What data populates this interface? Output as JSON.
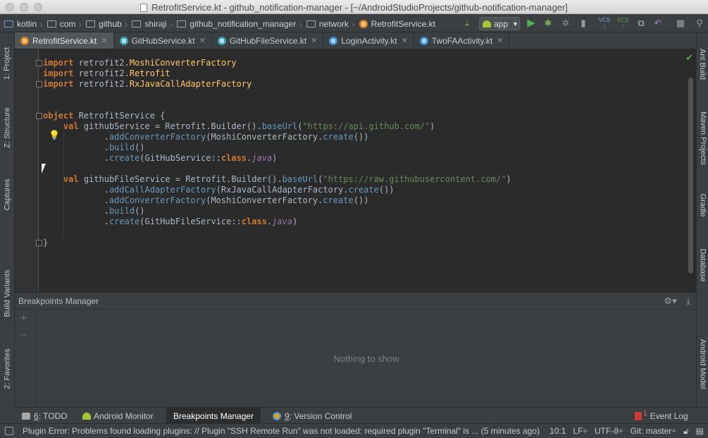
{
  "window": {
    "title": "RetrofitService.kt - github_notification-manager - [~/AndroidStudioProjects/github-notification-manager]"
  },
  "breadcrumbs": [
    {
      "label": "kotlin"
    },
    {
      "label": "com"
    },
    {
      "label": "github"
    },
    {
      "label": "shiraji"
    },
    {
      "label": "github_notification_manager"
    },
    {
      "label": "network"
    },
    {
      "label": "RetrofitService.kt"
    }
  ],
  "toolbar": {
    "run_config": "app",
    "vcs_label_1": "VCS",
    "vcs_label_2": "VCS"
  },
  "left_tools": {
    "project": "1: Project",
    "structure": "Z: Structure",
    "captures": "Captures",
    "build_variants": "Build Variants",
    "favorites": "2: Favorites"
  },
  "right_tools": {
    "ant": "Ant Build",
    "maven": "Maven Projects",
    "gradle": "Gradle",
    "database": "Database",
    "android_model": "Android Model"
  },
  "tabs": [
    {
      "label": "RetrofitService.kt",
      "active": true
    },
    {
      "label": "GitHubService.kt",
      "active": false
    },
    {
      "label": "GitHubFileService.kt",
      "active": false
    },
    {
      "label": "LoginActivity.kt",
      "active": false
    },
    {
      "label": "TwoFAActivity.kt",
      "active": false
    }
  ],
  "code": {
    "l1_kw": "import",
    "l1_pkg": " retrofit2.",
    "l1_cls": "MoshiConverterFactory",
    "l2_kw": "import",
    "l2_pkg": " retrofit2.",
    "l2_cls": "Retrofit",
    "l3_kw": "import",
    "l3_pkg": " retrofit2.",
    "l3_cls": "RxJavaCallAdapterFactory",
    "l6_kw": "object",
    "l6_rest": " RetrofitService {",
    "l7_kw": "val",
    "l7_a": " githubService = Retrofit.Builder().",
    "l7_fn": "baseUrl",
    "l7_b": "(",
    "l7_str": "\"https://api.github.com/\"",
    "l7_c": ")",
    "l8_dot": ".",
    "l8_fn": "addConverterFactory",
    "l8_a": "(MoshiConverterFactory.",
    "l8_fn2": "create",
    "l8_b": "())",
    "l9_dot": ".",
    "l9_fn": "build",
    "l9_a": "()",
    "l10_dot": ".",
    "l10_fn": "create",
    "l10_a": "(GitHubService::",
    "l10_kw": "class",
    "l10_dot2": ".",
    "l10_java": "java",
    "l10_b": ")",
    "l12_kw": "val",
    "l12_a": " githubFileService = Retrofit.Builder().",
    "l12_fn": "baseUrl",
    "l12_b": "(",
    "l12_str": "\"https://raw.githubusercontent.com/\"",
    "l12_c": ")",
    "l13_dot": ".",
    "l13_fn": "addCallAdapterFactory",
    "l13_a": "(RxJavaCallAdapterFactory.",
    "l13_fn2": "create",
    "l13_b": "())",
    "l14_dot": ".",
    "l14_fn": "addConverterFactory",
    "l14_a": "(MoshiConverterFactory.",
    "l14_fn2": "create",
    "l14_b": "())",
    "l15_dot": ".",
    "l15_fn": "build",
    "l15_a": "()",
    "l16_dot": ".",
    "l16_fn": "create",
    "l16_a": "(GitHubFileService::",
    "l16_kw": "class",
    "l16_dot2": ".",
    "l16_java": "java",
    "l16_b": ")",
    "l18": "}"
  },
  "breakpoints": {
    "title": "Breakpoints Manager",
    "empty_text": "Nothing to show",
    "add": "+",
    "remove": "−"
  },
  "bottom_tabs": {
    "todo_num": "6",
    "todo": ": TODO",
    "android_monitor": "Android Monitor",
    "breakpoints": "Breakpoints Manager",
    "vc_num": "9",
    "version_control": ": Version Control",
    "event_log_count": "1",
    "event_log": "Event Log"
  },
  "status": {
    "message": "Plugin Error: Problems found loading plugins: // Plugin \"SSH Remote Run\" was not loaded: required plugin \"Terminal\" is ... (5 minutes ago)",
    "position": "10:1",
    "line_sep": "LF÷",
    "encoding": "UTF-8÷",
    "git": "Git: master÷"
  },
  "icons": {
    "check": "✔",
    "bulb": "💡"
  }
}
